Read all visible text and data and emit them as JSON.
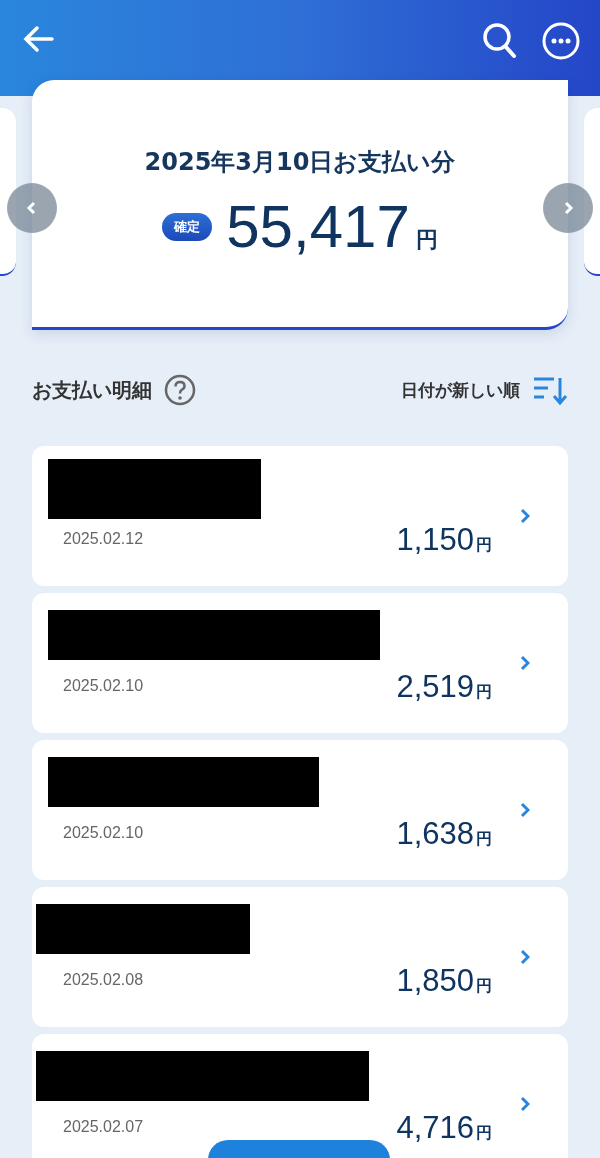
{
  "summary": {
    "title": "2025年3月10日お支払い分",
    "status_badge": "確定",
    "amount": "55,417",
    "currency": "円"
  },
  "section": {
    "title": "お支払い明細",
    "sort_label": "日付が新しい順"
  },
  "transactions": [
    {
      "date": "2025.02.12",
      "amount": "1,150",
      "currency": "円"
    },
    {
      "date": "2025.02.10",
      "amount": "2,519",
      "currency": "円"
    },
    {
      "date": "2025.02.10",
      "amount": "1,638",
      "currency": "円"
    },
    {
      "date": "2025.02.08",
      "amount": "1,850",
      "currency": "円"
    },
    {
      "date": "2025.02.07",
      "amount": "4,716",
      "currency": "円"
    }
  ]
}
